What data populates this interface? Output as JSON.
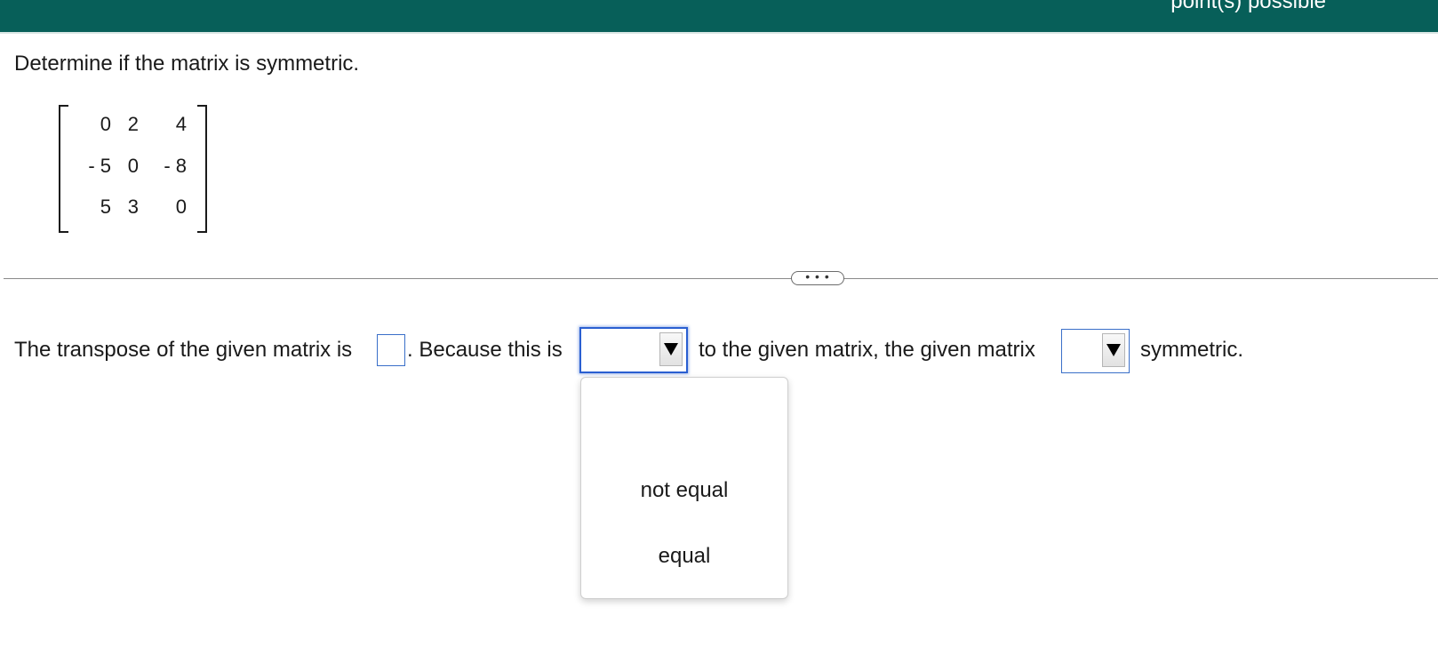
{
  "header": {
    "points_text": "point(s) possible"
  },
  "question": {
    "prompt": "Determine if the matrix is symmetric.",
    "matrix": [
      [
        "0",
        "2",
        "4"
      ],
      [
        "- 5",
        "0",
        "- 8"
      ],
      [
        "5",
        "3",
        "0"
      ]
    ]
  },
  "divider": {
    "expand_label": "• • •"
  },
  "answer": {
    "text_1": "The transpose of the given matrix is",
    "text_2": ". Because this is",
    "text_3": "to the given matrix, the given matrix",
    "text_4": "symmetric.",
    "select_1_value": "",
    "select_2_value": "",
    "dropdown_options": [
      "not equal",
      "equal"
    ]
  },
  "colors": {
    "header_bg": "#075f59",
    "focus_blue": "#2a5fd1"
  },
  "icons": {
    "select_arrow": "triangle-down-icon"
  }
}
